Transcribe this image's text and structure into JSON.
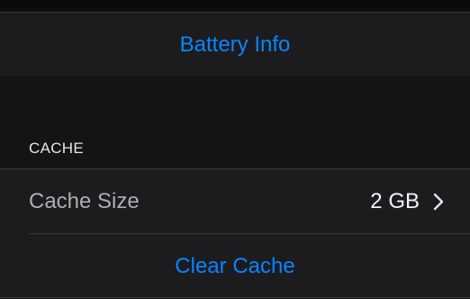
{
  "battery_section": {
    "battery_info_label": "Battery Info"
  },
  "cache_section": {
    "header": "CACHE",
    "cache_size_label": "Cache Size",
    "cache_size_value": "2 GB",
    "clear_cache_label": "Clear Cache"
  },
  "icons": {
    "disclosure": "chevron-right-icon"
  },
  "colors": {
    "accent": "#0a84ff",
    "background": "#1c1c1e",
    "separator": "#3a3a3c"
  }
}
